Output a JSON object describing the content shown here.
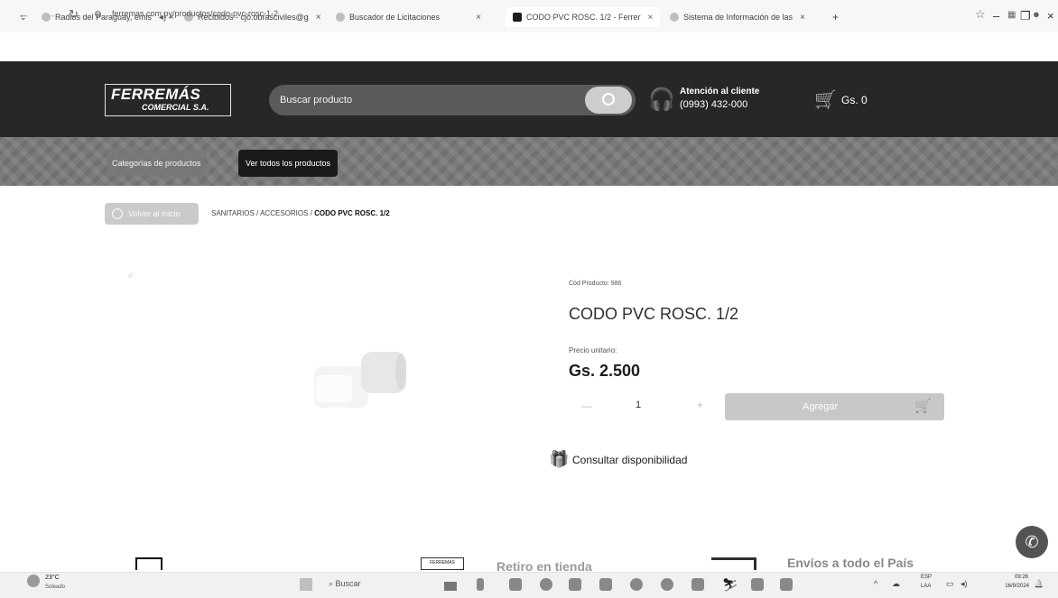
{
  "browser": {
    "tabs": [
      {
        "label": "Radios del Paraguay, emis"
      },
      {
        "label": "Recibidos - cjo.obrasciviles@g"
      },
      {
        "label": "Buscador de Licitaciones"
      },
      {
        "label": "CODO PVC ROSC. 1/2 - Ferrer"
      },
      {
        "label": "Sistema de Información de las"
      }
    ],
    "new_tab": "+",
    "url": "ferremas.com.py/productos/codo-pvc-rosc-1-2"
  },
  "header": {
    "logo_main": "FERREMÁS",
    "logo_sub": "COMERCIAL S.A.",
    "search_placeholder": "Buscar producto",
    "help_title": "Atención al cliente",
    "help_phone": "(0993) 432-000",
    "cart_total": "Gs. 0"
  },
  "nav": {
    "categories": "Categorías de productos",
    "all_products": "Ver todos los productos"
  },
  "breadcrumb": {
    "back": "Volver al inicio",
    "path": "SANITARIOS / ACCESORIOS /",
    "current": "CODO PVC ROSC. 1/2"
  },
  "product": {
    "code": "Cód Producto: 986",
    "title": "CODO PVC ROSC. 1/2",
    "price_label": "Precio unitario:",
    "price": "Gs. 2.500",
    "quantity": "1",
    "minus": "—",
    "plus": "+",
    "add_label": "Agregar",
    "availability": "Consultar disponibilidad"
  },
  "features": {
    "pickup": "Retiro en tienda",
    "pickup_sign": "FERREMÁS",
    "shipping": "Envíos a todo el País"
  },
  "taskbar": {
    "temperature": "23°C",
    "weather": "Soleado",
    "search": "Buscar",
    "lang1": "ESP",
    "lang2": "LAA",
    "time": "09:26",
    "date": "16/9/2024"
  },
  "colors": {
    "header_bg": "#2b2b2b",
    "accent_button": "#c5c5c5"
  }
}
